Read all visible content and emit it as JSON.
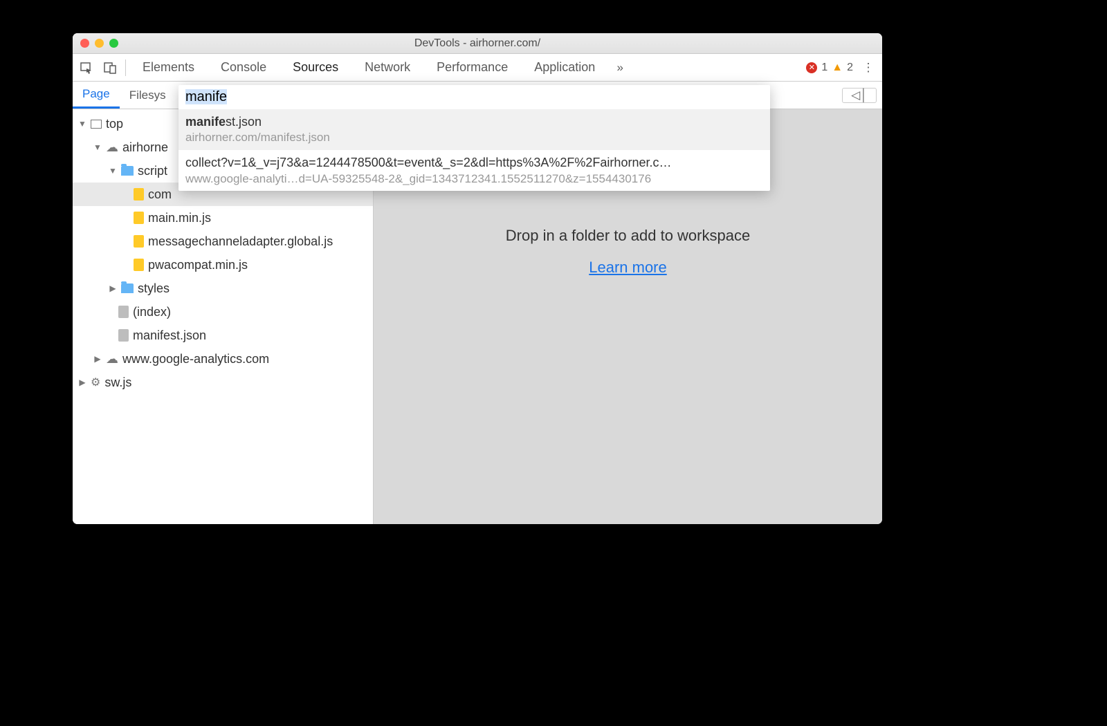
{
  "window": {
    "title": "DevTools - airhorner.com/"
  },
  "toolbar": {
    "tabs": [
      "Elements",
      "Console",
      "Sources",
      "Network",
      "Performance",
      "Application"
    ],
    "active_tab": "Sources",
    "errors": "1",
    "warnings": "2"
  },
  "subtabs": {
    "items": [
      "Page",
      "Filesys"
    ],
    "active": "Page"
  },
  "sidebar": {
    "top": "top",
    "domain": "airhorne",
    "scripts_folder": "script",
    "scripts": [
      "com",
      "main.min.js",
      "messagechanneladapter.global.js",
      "pwacompat.min.js"
    ],
    "styles_folder": "styles",
    "index_file": "(index)",
    "manifest_file": "manifest.json",
    "ga_domain": "www.google-analytics.com",
    "sw_file": "sw.js"
  },
  "omnibox": {
    "query": "manife",
    "results": [
      {
        "match_bold": "manife",
        "match_rest": "st.json",
        "subtitle": "airhorner.com/manifest.json"
      },
      {
        "title": "collect?v=1&_v=j73&a=1244478500&t=event&_s=2&dl=https%3A%2F%2Fairhorner.c…",
        "subtitle": "www.google-analyti…d=UA-59325548-2&_gid=1343712341.1552511270&z=1554430176"
      }
    ]
  },
  "main": {
    "drop_text": "Drop in a folder to add to workspace",
    "learn_more": "Learn more"
  }
}
